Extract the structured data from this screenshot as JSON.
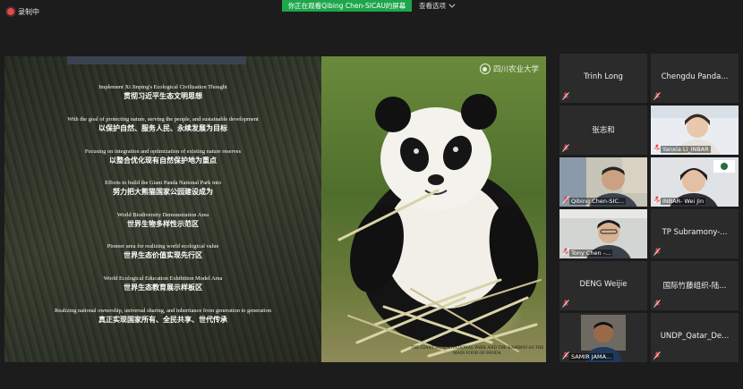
{
  "recording": {
    "label": "录制中"
  },
  "share_banner": {
    "text": "你正在观看Qibing Chen-SICAU的屏幕"
  },
  "view_options": {
    "label": "查看选项"
  },
  "slide": {
    "logo_text": "四川农业大学",
    "caption": "THE GIANT PANDA NATIONAL PARK AND THE BAMBOO AS THE MAIN FOOD OF PANDA",
    "lines": [
      {
        "en": "Implement Xi Jinping's Ecological Civilization Thought",
        "cn": "贯彻习近平生态文明思想"
      },
      {
        "en": "With the goal of protecting nature, serving the people, and sustainable development",
        "cn": "以保护自然、服务人民、永续发展为目标"
      },
      {
        "en": "Focusing on integration and optimization of existing nature reserves",
        "cn": "以整合优化现有自然保护地为重点"
      },
      {
        "en": "Efforts to build the Giant Panda National Park into",
        "cn": "努力把大熊猫国家公园建设成为"
      },
      {
        "en": "World Biodiversity Demonstration Area",
        "cn": "世界生物多样性示范区"
      },
      {
        "en": "Pioneer area for realizing world ecological value",
        "cn": "世界生态价值实现先行区"
      },
      {
        "en": "World Ecological Education Exhibition Model Area",
        "cn": "世界生态教育展示样板区"
      },
      {
        "en": "Realizing national ownership, universal sharing, and inheritance from generation to generation",
        "cn": "真正实现国家所有、全民共享、世代传承"
      }
    ]
  },
  "participants": [
    {
      "name": "Trinh Long",
      "video": false
    },
    {
      "name": "Chengdu  Panda...",
      "video": false
    },
    {
      "name": "张志和",
      "video": false
    },
    {
      "name": "Yanxia Li_INBAR",
      "video": true
    },
    {
      "name": "Qibing Chen-SIC...",
      "video": true,
      "active": true
    },
    {
      "name": "INBAR- Wei Jin",
      "video": true
    },
    {
      "name": "Tony Chen -...",
      "video": true
    },
    {
      "name": "TP  Subramony-...",
      "video": false
    },
    {
      "name": "DENG Weijie",
      "video": false
    },
    {
      "name": "国际竹藤组织-陆...",
      "video": false
    },
    {
      "name": "SAMIR JAMA...",
      "video": true
    },
    {
      "name": "UNDP_Qatar_De...",
      "video": false
    }
  ],
  "colors": {
    "banner": "#1ea64b",
    "mic_off": "#e34b4b",
    "active_speaker": "#2fc55a"
  }
}
